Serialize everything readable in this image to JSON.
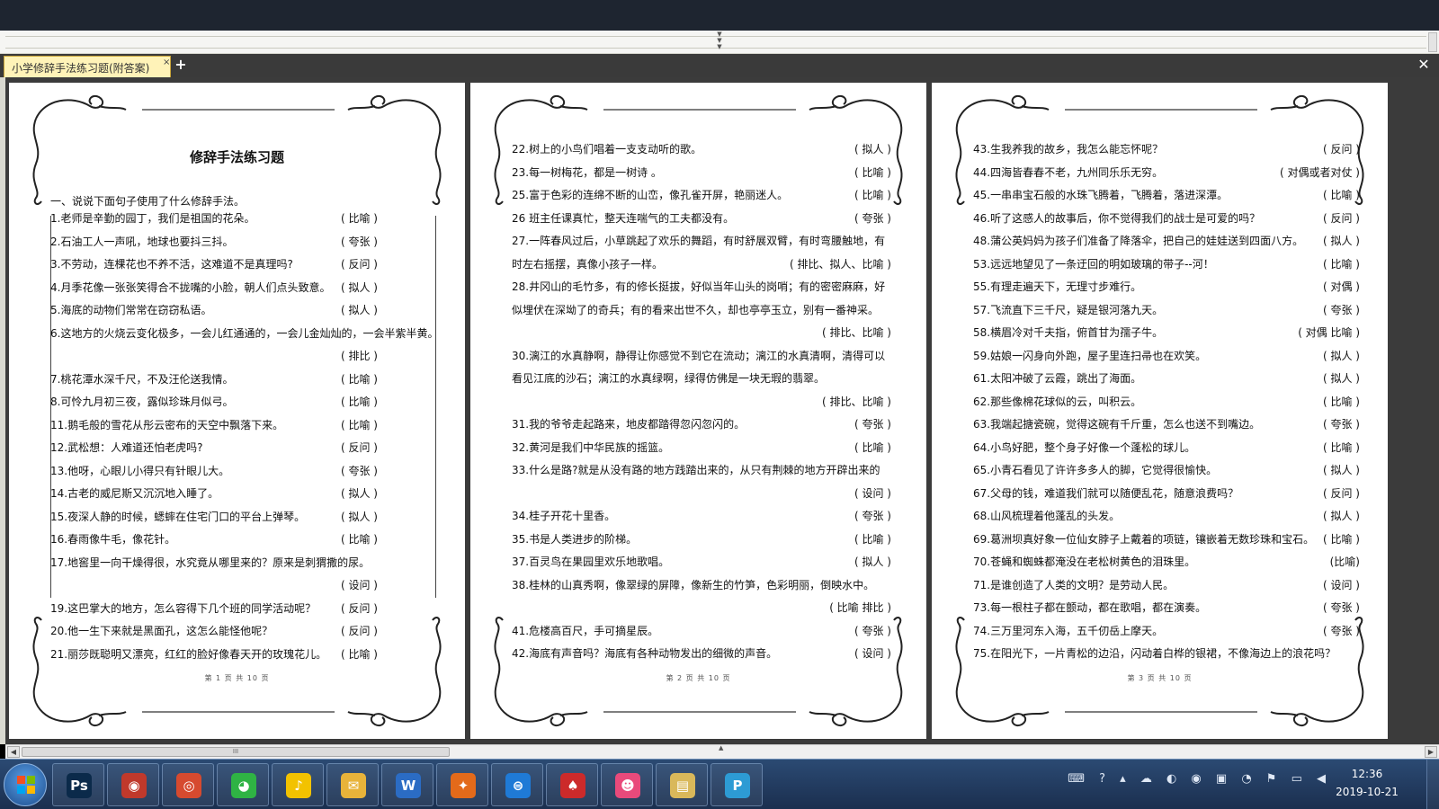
{
  "tabs": [
    {
      "label": "小学修辞手法练习题(附答案)",
      "close": "×"
    }
  ],
  "tabbar": {
    "add": "+",
    "close_window": "✕"
  },
  "page1": {
    "title": "修辞手法练习题",
    "section_heading": "一、说说下面句子使用了什么修辞手法。",
    "footer": "第 1 页 共 10 页",
    "lines": [
      {
        "q": "1.老师是辛勤的园丁，我们是祖国的花朵。",
        "a": "( 比喻 )"
      },
      {
        "q": "2.石油工人一声吼，地球也要抖三抖。",
        "a": "( 夸张 )"
      },
      {
        "q": "3.不劳动，连棵花也不养不活，这难道不是真理吗?",
        "a": "( 反问 )"
      },
      {
        "q": "4.月季花像一张张笑得合不拢嘴的小脸，朝人们点头致意。",
        "a": "( 拟人 )"
      },
      {
        "q": "5.海底的动物们常常在窃窃私语。",
        "a": "( 拟人 )"
      },
      {
        "q": "6.这地方的火烧云变化极多，一会儿红通通的，一会儿金灿灿的，一会半紫半黄。",
        "a": ""
      },
      {
        "q": "",
        "a": "( 排比 )"
      },
      {
        "q": "7.桃花潭水深千尺，不及汪伦送我情。",
        "a": "( 比喻 )"
      },
      {
        "q": "8.可怜九月初三夜，露似珍珠月似弓。",
        "a": "( 比喻 )"
      },
      {
        "q": "11.鹅毛般的雪花从彤云密布的天空中飘落下来。",
        "a": "( 比喻 )"
      },
      {
        "q": "12.武松想：人难道还怕老虎吗?",
        "a": "( 反问 )"
      },
      {
        "q": "13.他呀，心眼儿小得只有针眼儿大。",
        "a": "( 夸张 )"
      },
      {
        "q": "14.古老的威尼斯又沉沉地入睡了。",
        "a": "( 拟人 )"
      },
      {
        "q": "15.夜深人静的时候，蟋蟀在住宅门口的平台上弹琴。",
        "a": "( 拟人 )"
      },
      {
        "q": "16.春雨像牛毛，像花针。",
        "a": "( 比喻 )"
      },
      {
        "q": "17.地窖里一向干燥得很，水究竟从哪里来的？原来是刺猬撒的尿。",
        "a": ""
      },
      {
        "q": "",
        "a": "( 设问 )"
      },
      {
        "q": "19.这巴掌大的地方，怎么容得下几个班的同学活动呢？",
        "a": "( 反问 )"
      },
      {
        "q": "20.他一生下来就是黑面孔，这怎么能怪他呢？",
        "a": "( 反问 )"
      },
      {
        "q": "21.丽莎既聪明又漂亮，红红的脸好像春天开的玫瑰花儿。",
        "a": "( 比喻 )"
      }
    ]
  },
  "page2": {
    "footer": "第 2 页 共 10 页",
    "lines": [
      {
        "q": "22.树上的小鸟们唱着一支支动听的歌。",
        "a": "( 拟人 )"
      },
      {
        "q": "23.每一树梅花，都是一树诗 。",
        "a": "( 比喻 )"
      },
      {
        "q": "25.富于色彩的连绵不断的山峦，像孔雀开屏，艳丽迷人。",
        "a": "( 比喻 )"
      },
      {
        "q": "26 班主任课真忙，整天连喘气的工夫都没有。",
        "a": "( 夸张 )"
      },
      {
        "q": "27.一阵春风过后，小草跳起了欢乐的舞蹈，有时舒展双臂，有时弯腰触地，有",
        "a": ""
      },
      {
        "q": "时左右摇摆，真像小孩子一样。",
        "a": "( 排比、拟人、比喻 )"
      },
      {
        "q": "28.井冈山的毛竹多，有的修长挺拔，好似当年山头的岗哨；有的密密麻麻，好",
        "a": ""
      },
      {
        "q": "似埋伏在深坳了的奇兵；有的看来出世不久，却也亭亭玉立，别有一番神采。",
        "a": ""
      },
      {
        "q": "",
        "a": "( 排比、比喻 )"
      },
      {
        "q": "30.漓江的水真静啊，静得让你感觉不到它在流动；漓江的水真清啊，清得可以",
        "a": ""
      },
      {
        "q": "看见江底的沙石；漓江的水真绿啊，绿得仿佛是一块无瑕的翡翠。",
        "a": ""
      },
      {
        "q": "",
        "a": "( 排比、比喻 )"
      },
      {
        "q": "31.我的爷爷走起路来，地皮都踏得忽闪忽闪的。",
        "a": "( 夸张 )"
      },
      {
        "q": "32.黄河是我们中华民族的摇篮。",
        "a": "( 比喻 )"
      },
      {
        "q": "33.什么是路?就是从没有路的地方践踏出来的，从只有荆棘的地方开辟出来的",
        "a": ""
      },
      {
        "q": "",
        "a": "( 设问 )"
      },
      {
        "q": "34.桂子开花十里香。",
        "a": "( 夸张 )"
      },
      {
        "q": "35.书是人类进步的阶梯。",
        "a": "( 比喻 )"
      },
      {
        "q": "37.百灵鸟在果园里欢乐地歌唱。",
        "a": "( 拟人 )"
      },
      {
        "q": "38.桂林的山真秀啊，像翠绿的屏障，像新生的竹笋，色彩明丽，倒映水中。",
        "a": ""
      },
      {
        "q": "",
        "a": "( 比喻  排比 )"
      },
      {
        "q": "41.危楼高百尺，手可摘星辰。",
        "a": "( 夸张 )"
      },
      {
        "q": "42.海底有声音吗？海底有各种动物发出的细微的声音。",
        "a": "( 设问 )"
      }
    ]
  },
  "page3": {
    "footer": "第 3 页 共 10 页",
    "lines": [
      {
        "q": "43.生我养我的故乡，我怎么能忘怀呢？",
        "a": "( 反问 )"
      },
      {
        "q": "44.四海皆春春不老，九州同乐乐无穷。",
        "a": "( 对偶或者对仗 )"
      },
      {
        "q": "45.一串串宝石般的水珠飞腾着，飞腾着，落进深潭。",
        "a": "( 比喻 )"
      },
      {
        "q": "46.听了这感人的故事后，你不觉得我们的战士是可爱的吗？",
        "a": "( 反问 )"
      },
      {
        "q": "48.蒲公英妈妈为孩子们准备了降落伞，把自己的娃娃送到四面八方。",
        "a": "( 拟人 )"
      },
      {
        "q": "53.远远地望见了一条迂回的明如玻璃的带子--河！",
        "a": "( 比喻 )"
      },
      {
        "q": "55.有理走遍天下，无理寸步难行。",
        "a": "( 对偶 )"
      },
      {
        "q": "57.飞流直下三千尺，疑是银河落九天。",
        "a": "( 夸张 )"
      },
      {
        "q": "58.横眉冷对千夫指，俯首甘为孺子牛。",
        "a": "( 对偶  比喻 )"
      },
      {
        "q": "59.姑娘一闪身向外跑，屋子里连扫帚也在欢笑。",
        "a": "( 拟人 )"
      },
      {
        "q": "61.太阳冲破了云霞，跳出了海面。",
        "a": "( 拟人 )"
      },
      {
        "q": "62.那些像棉花球似的云，叫积云。",
        "a": "( 比喻 )"
      },
      {
        "q": "63.我端起搪瓷碗，觉得这碗有千斤重，怎么也送不到嘴边。",
        "a": "( 夸张 )"
      },
      {
        "q": "64.小鸟好肥，整个身子好像一个蓬松的球儿。",
        "a": "( 比喻 )"
      },
      {
        "q": "65.小青石看见了许许多多人的脚，它觉得很愉快。",
        "a": "( 拟人 )"
      },
      {
        "q": "67.父母的钱，难道我们就可以随便乱花，随意浪费吗？",
        "a": "( 反问 )"
      },
      {
        "q": "68.山风梳理着他蓬乱的头发。",
        "a": "( 拟人 )"
      },
      {
        "q": "69.葛洲坝真好象一位仙女脖子上戴着的项链，镶嵌着无数珍珠和宝石。",
        "a": "( 比喻 )"
      },
      {
        "q": "70.苍蝇和蜘蛛都淹没在老松树黄色的泪珠里。",
        "a": "(比喻)"
      },
      {
        "q": "71.是谁创造了人类的文明？是劳动人民。",
        "a": "( 设问 )"
      },
      {
        "q": "73.每一根柱子都在颤动，都在歌唱，都在演奏。",
        "a": "( 夸张 )"
      },
      {
        "q": "74.三万里河东入海，五千仞岳上摩天。",
        "a": "( 夸张 )"
      },
      {
        "q": "75.在阳光下，一片青松的边沿，闪动着白桦的银裙，不像海边上的浪花吗？",
        "a": ""
      }
    ]
  },
  "taskbar": {
    "apps": [
      "Ps",
      "◉",
      "◎",
      "◕",
      "♪",
      "✉",
      "W",
      "✦",
      "⊜",
      "♠",
      "☻",
      "▤",
      "P"
    ],
    "app_names": [
      "photoshop-icon",
      "picasa-icon",
      "chrome-icon",
      "wechat-icon",
      "music-icon",
      "mail-icon",
      "word-icon",
      "firefox-icon",
      "browser-icon",
      "cards-icon",
      "game-icon",
      "explorer-icon",
      "pdf-icon"
    ],
    "app_colors": [
      "#0b2a4a",
      "#c0392b",
      "#d64a2f",
      "#2fb344",
      "#f2c200",
      "#e8b33a",
      "#2b6cc4",
      "#e36a1a",
      "#1f7ad6",
      "#cc2a2a",
      "#e94a7b",
      "#d9b85a",
      "#2d9bd4"
    ],
    "tray": "⌨ ? ▴ ☁ ◐ ◉ ▣ ◔ ⚑ ▭ ◀",
    "time": "12:36",
    "date": "2019-10-21"
  },
  "scrollbar": {
    "thumb": "III"
  }
}
